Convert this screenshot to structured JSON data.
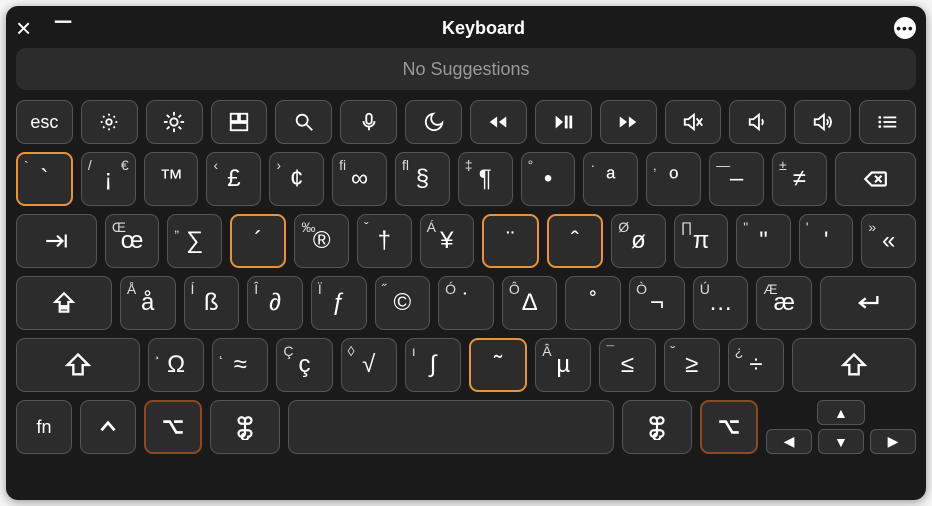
{
  "window": {
    "title": "Keyboard"
  },
  "suggestions_text": "No Suggestions",
  "fn_row": {
    "esc": "esc",
    "icons": [
      "brightness-down-icon",
      "brightness-up-icon",
      "mission-control-icon",
      "spotlight-icon",
      "dictation-icon",
      "do-not-disturb-icon",
      "rewind-icon",
      "play-pause-icon",
      "forward-icon",
      "mute-icon",
      "volume-down-icon",
      "volume-up-icon",
      "list-icon"
    ]
  },
  "row1": [
    {
      "tl": "`",
      "main": "`",
      "orange": true,
      "name": "key-grave"
    },
    {
      "tl": "/",
      "tr": "€",
      "main": "¡",
      "name": "key-inverted-exclaim"
    },
    {
      "tl": "",
      "tr": "",
      "main": "™",
      "name": "key-trademark"
    },
    {
      "tl": "‹",
      "main": "£",
      "name": "key-pound"
    },
    {
      "tl": "›",
      "main": "¢",
      "name": "key-cent"
    },
    {
      "tl": "fi",
      "main": "∞",
      "name": "key-infinity"
    },
    {
      "tl": "fl",
      "main": "§",
      "name": "key-section"
    },
    {
      "tl": "‡",
      "main": "¶",
      "name": "key-pilcrow"
    },
    {
      "tl": "°",
      "main": "•",
      "name": "key-bullet"
    },
    {
      "tl": "·",
      "main": "ª",
      "name": "key-ordinal-a"
    },
    {
      "tl": "‚",
      "main": "º",
      "name": "key-ordinal-o"
    },
    {
      "tl": "—",
      "main": "–",
      "name": "key-endash"
    },
    {
      "tl": "±",
      "main": "≠",
      "name": "key-notequal"
    },
    {
      "main": "backspace",
      "name": "key-backspace",
      "icon": true
    }
  ],
  "row2": [
    {
      "main": "tab",
      "name": "key-tab",
      "icon": true
    },
    {
      "tl": "Œ",
      "main": "œ",
      "name": "key-oe"
    },
    {
      "tl": "„",
      "main": "∑",
      "name": "key-sigma"
    },
    {
      "tl": "",
      "main": "´",
      "orange": true,
      "name": "key-acute"
    },
    {
      "tl": "‰",
      "main": "®",
      "name": "key-registered"
    },
    {
      "tl": "ˇ",
      "main": "†",
      "name": "key-dagger"
    },
    {
      "tl": "Á",
      "main": "¥",
      "name": "key-yen"
    },
    {
      "tl": "",
      "main": "¨",
      "orange": true,
      "name": "key-diaeresis"
    },
    {
      "tl": "",
      "main": "ˆ",
      "orange": true,
      "name": "key-circumflex"
    },
    {
      "tl": "Ø",
      "main": "ø",
      "name": "key-oslash"
    },
    {
      "tl": "∏",
      "main": "π",
      "name": "key-pi"
    },
    {
      "tl": "\"",
      "main": "\"",
      "name": "key-leftquote"
    },
    {
      "tl": "'",
      "main": "'",
      "name": "key-rightquote"
    },
    {
      "tl": "»",
      "main": "«",
      "name": "key-guillemet"
    }
  ],
  "row3": [
    {
      "main": "capslock",
      "name": "key-capslock",
      "icon": true
    },
    {
      "tl": "Å",
      "main": "å",
      "name": "key-a-ring"
    },
    {
      "tl": "Í",
      "main": "ß",
      "name": "key-eszett"
    },
    {
      "tl": "Î",
      "main": "∂",
      "name": "key-partial"
    },
    {
      "tl": "Ï",
      "main": "ƒ",
      "name": "key-florin"
    },
    {
      "tl": "˝",
      "main": "©",
      "name": "key-copyright"
    },
    {
      "tl": "Ó",
      "main": "˙",
      "name": "key-dot"
    },
    {
      "tl": "Ô",
      "main": "∆",
      "name": "key-delta"
    },
    {
      "tl": "",
      "main": "˚",
      "name": "key-ring"
    },
    {
      "tl": "Ò",
      "main": "¬",
      "name": "key-not"
    },
    {
      "tl": "Ú",
      "main": "…",
      "name": "key-ellipsis"
    },
    {
      "tl": "Æ",
      "main": "æ",
      "name": "key-ae"
    },
    {
      "main": "return",
      "name": "key-return",
      "icon": true
    }
  ],
  "row4": [
    {
      "main": "shift",
      "name": "key-shift-left",
      "icon": true
    },
    {
      "tl": "¸",
      "main": "Ω",
      "name": "key-omega"
    },
    {
      "tl": "˛",
      "main": "≈",
      "name": "key-approx"
    },
    {
      "tl": "Ç",
      "main": "ç",
      "name": "key-ccedilla"
    },
    {
      "tl": "◊",
      "main": "√",
      "name": "key-sqrt"
    },
    {
      "tl": "ı",
      "main": "∫",
      "name": "key-integral"
    },
    {
      "tl": "",
      "main": "˜",
      "orange": true,
      "name": "key-tilde"
    },
    {
      "tl": "Â",
      "main": "µ",
      "name": "key-mu"
    },
    {
      "tl": "¯",
      "main": "≤",
      "name": "key-lte"
    },
    {
      "tl": "˘",
      "main": "≥",
      "name": "key-gte"
    },
    {
      "tl": "¿",
      "main": "÷",
      "name": "key-divide"
    },
    {
      "main": "shift",
      "name": "key-shift-right",
      "icon": true
    }
  ],
  "row5": {
    "fn": "fn",
    "keys": [
      {
        "name": "key-control",
        "icon": "control-icon"
      },
      {
        "name": "key-option-left",
        "icon": "option-icon",
        "darkorange": true
      },
      {
        "name": "key-command-left",
        "icon": "command-icon"
      },
      {
        "name": "key-space",
        "space": true
      },
      {
        "name": "key-command-right",
        "icon": "command-icon"
      },
      {
        "name": "key-option-right",
        "icon": "option-icon",
        "darkorange": true
      }
    ],
    "arrows": {
      "up": "▲",
      "left": "◀",
      "down": "▼",
      "right": "▶"
    }
  }
}
